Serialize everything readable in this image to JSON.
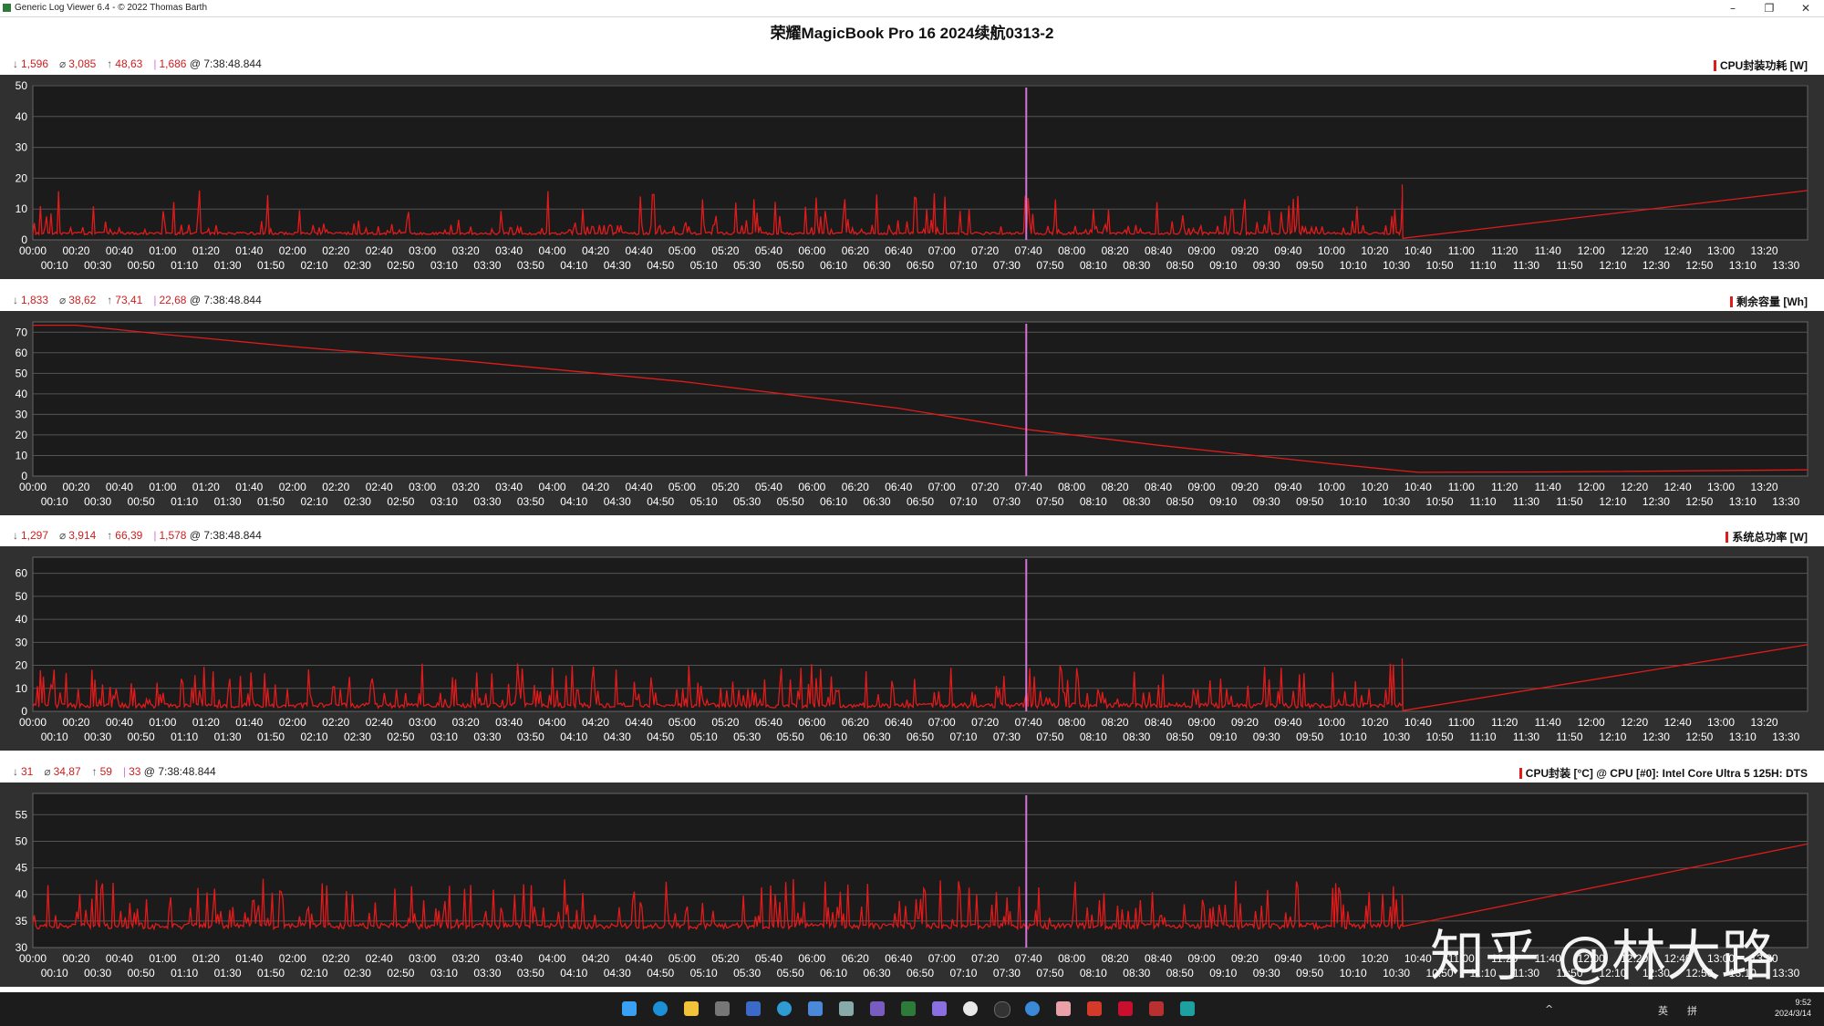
{
  "window": {
    "title": "Generic Log Viewer 6.4 - © 2022 Thomas Barth"
  },
  "chart_title": "荣耀MagicBook Pro 16 2024续航0313-2",
  "cursor_time": "7:38:48.844",
  "colors": {
    "series": "#e01b1b",
    "cursor": "#d674d6",
    "plot_bg": "#1b1b1b",
    "panel_bg": "#303030",
    "grid": "#555555"
  },
  "x_ticks_upper": [
    "00:00",
    "00:20",
    "00:40",
    "01:00",
    "01:20",
    "01:40",
    "02:00",
    "02:20",
    "02:40",
    "03:00",
    "03:20",
    "03:40",
    "04:00",
    "04:20",
    "04:40",
    "05:00",
    "05:20",
    "05:40",
    "06:00",
    "06:20",
    "06:40",
    "07:00",
    "07:20",
    "07:40",
    "08:00",
    "08:20",
    "08:40",
    "09:00",
    "09:20",
    "09:40",
    "10:00",
    "10:20",
    "10:40",
    "11:00",
    "11:20",
    "11:40",
    "12:00",
    "12:20",
    "12:40",
    "13:00",
    "13:20"
  ],
  "x_ticks_lower": [
    "00:10",
    "00:30",
    "00:50",
    "01:10",
    "01:30",
    "01:50",
    "02:10",
    "02:30",
    "02:50",
    "03:10",
    "03:30",
    "03:50",
    "04:10",
    "04:30",
    "04:50",
    "05:10",
    "05:30",
    "05:50",
    "06:10",
    "06:30",
    "06:50",
    "07:10",
    "07:30",
    "07:50",
    "08:10",
    "08:30",
    "08:50",
    "09:10",
    "09:30",
    "09:50",
    "10:10",
    "10:30",
    "10:50",
    "11:10",
    "11:30",
    "11:50",
    "12:10",
    "12:30",
    "12:50",
    "13:10",
    "13:30"
  ],
  "panels": [
    {
      "label": "CPU封装功耗 [W]",
      "min": "1,596",
      "avg": "3,085",
      "max": "48,63",
      "cur": "1,686",
      "cur_time": "7:38:48.844"
    },
    {
      "label": "剩余容量 [Wh]",
      "min": "1,833",
      "avg": "38,62",
      "max": "73,41",
      "cur": "22,68",
      "cur_time": "7:38:48.844"
    },
    {
      "label": "系统总功率 [W]",
      "min": "1,297",
      "avg": "3,914",
      "max": "66,39",
      "cur": "1,578",
      "cur_time": "7:38:48.844"
    },
    {
      "label": "CPU封装 [°C] @ CPU [#0]: Intel Core Ultra 5 125H: DTS",
      "min": "31",
      "avg": "34,87",
      "max": "59",
      "cur": "33",
      "cur_time": "7:38:48.844"
    }
  ],
  "chart_data": [
    {
      "type": "line",
      "title": "CPU封装功耗 [W]",
      "x_unit": "minutes",
      "xlim": [
        0,
        820
      ],
      "ylim": [
        0,
        50
      ],
      "y_ticks": [
        0,
        10,
        20,
        30,
        40,
        50
      ],
      "grid": true,
      "cursor_x": 459,
      "pattern": "spiky",
      "pattern_end": 633,
      "baseline": 1.7,
      "peak_range": [
        5,
        16
      ],
      "final_spike": 18,
      "tail": [
        [
          633,
          0.5
        ],
        [
          820,
          16
        ]
      ]
    },
    {
      "type": "line",
      "title": "剩余容量 [Wh]",
      "x_unit": "minutes",
      "xlim": [
        0,
        820
      ],
      "ylim": [
        0,
        75
      ],
      "y_ticks": [
        0,
        10,
        20,
        30,
        40,
        50,
        60,
        70
      ],
      "grid": true,
      "cursor_x": 459,
      "pattern": "smooth",
      "points": [
        [
          0,
          73.4
        ],
        [
          20,
          73.4
        ],
        [
          60,
          69
        ],
        [
          120,
          63
        ],
        [
          200,
          56
        ],
        [
          300,
          46
        ],
        [
          400,
          33
        ],
        [
          459,
          22.7
        ],
        [
          520,
          15
        ],
        [
          600,
          6
        ],
        [
          640,
          1.8
        ],
        [
          700,
          2
        ],
        [
          820,
          3
        ]
      ]
    },
    {
      "type": "line",
      "title": "系统总功率 [W]",
      "x_unit": "minutes",
      "xlim": [
        0,
        820
      ],
      "ylim": [
        0,
        67
      ],
      "y_ticks": [
        0,
        10,
        20,
        30,
        40,
        50,
        60
      ],
      "grid": true,
      "cursor_x": 459,
      "pattern": "spiky",
      "pattern_end": 633,
      "baseline": 1.5,
      "peak_range": [
        10,
        21
      ],
      "final_spike": 23,
      "tail": [
        [
          633,
          0.3
        ],
        [
          820,
          29
        ]
      ]
    },
    {
      "type": "line",
      "title": "CPU封装 [°C]",
      "x_unit": "minutes",
      "xlim": [
        0,
        820
      ],
      "ylim": [
        30,
        59
      ],
      "y_ticks": [
        30,
        35,
        40,
        45,
        50,
        55
      ],
      "grid": true,
      "cursor_x": 459,
      "pattern": "spiky",
      "pattern_end": 633,
      "baseline": 33.5,
      "peak_range": [
        38,
        43
      ],
      "final_spike": 40,
      "tail": [
        [
          633,
          34
        ],
        [
          820,
          49.5
        ]
      ]
    }
  ],
  "taskbar": {
    "tray_items": [
      "英",
      "拼"
    ],
    "clock_time": "9:52",
    "clock_date": "2024/3/14"
  },
  "watermark": "知乎 @林大路"
}
